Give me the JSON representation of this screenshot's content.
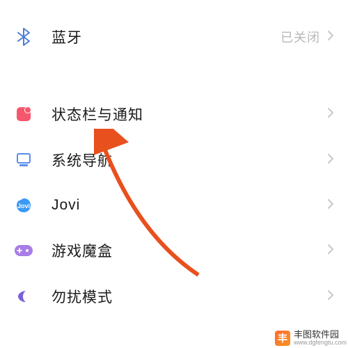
{
  "items": {
    "bluetooth": {
      "label": "蓝牙",
      "status": "已关闭"
    },
    "notification": {
      "label": "状态栏与通知"
    },
    "navigation": {
      "label": "系统导航"
    },
    "jovi": {
      "label": "Jovi"
    },
    "gamebox": {
      "label": "游戏魔盒"
    },
    "dnd": {
      "label": "勿扰模式"
    }
  },
  "watermark": {
    "logo_text": "丰",
    "name": "丰图软件园",
    "url": "www.dgfengtu.com"
  }
}
